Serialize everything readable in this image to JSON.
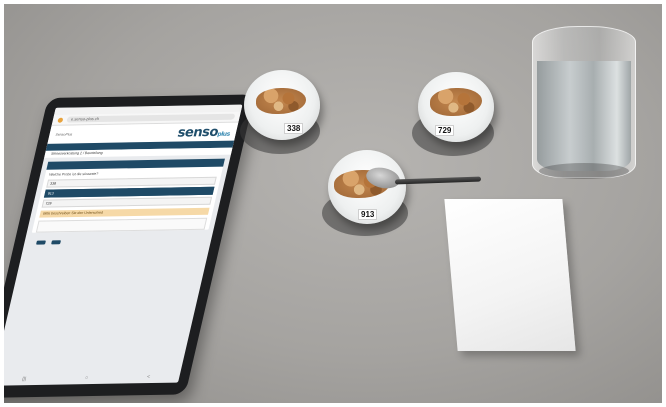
{
  "tablet": {
    "url": "e.senso-plus.ch",
    "logo_main": "senso",
    "logo_sub": "plus",
    "menu": "SensoPlus",
    "crumb": "Sinnesverkostung 2 / Beurteilung",
    "question": "Welche Probe ist die süsseste?",
    "options": [
      "338",
      "913",
      "729"
    ],
    "selected_index": 1,
    "hint": "Bitte beschreiben Sie den Unterschied"
  },
  "cups": [
    {
      "code": "338"
    },
    {
      "code": "729"
    },
    {
      "code": "913"
    }
  ],
  "colors": {
    "brand_navy": "#1f4a66",
    "hint_orange": "#f6d9a7",
    "table_gray": "#a5a3a0"
  }
}
